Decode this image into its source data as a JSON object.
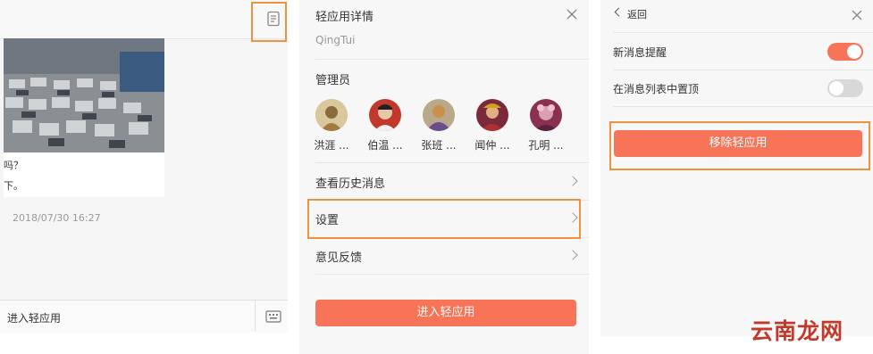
{
  "chat_panel": {
    "card_lines": [
      "吗？",
      "下。"
    ],
    "timestamp": "2018/07/30 16:27",
    "enter_label": "进入轻应用"
  },
  "detail_panel": {
    "title": "轻应用详情",
    "app_name": "QingTui",
    "admins_label": "管理员",
    "admins": [
      {
        "name": "洪涯 ..."
      },
      {
        "name": "伯温 ..."
      },
      {
        "name": "张班 ..."
      },
      {
        "name": "闻仲 ..."
      },
      {
        "name": "孔明 ..."
      }
    ],
    "menu": [
      {
        "label": "查看历史消息"
      },
      {
        "label": "设置"
      },
      {
        "label": "意见反馈"
      }
    ],
    "enter_button": "进入轻应用"
  },
  "settings_panel": {
    "back_label": "返回",
    "notify_label": "新消息提醒",
    "notify_on": true,
    "pin_label": "在消息列表中置顶",
    "pin_on": false,
    "remove_button": "移除轻应用"
  },
  "colors": {
    "accent": "#f77459",
    "highlight": "#f0913e",
    "toggle_off": "#d8d8d8"
  },
  "watermark": "云南龙网"
}
